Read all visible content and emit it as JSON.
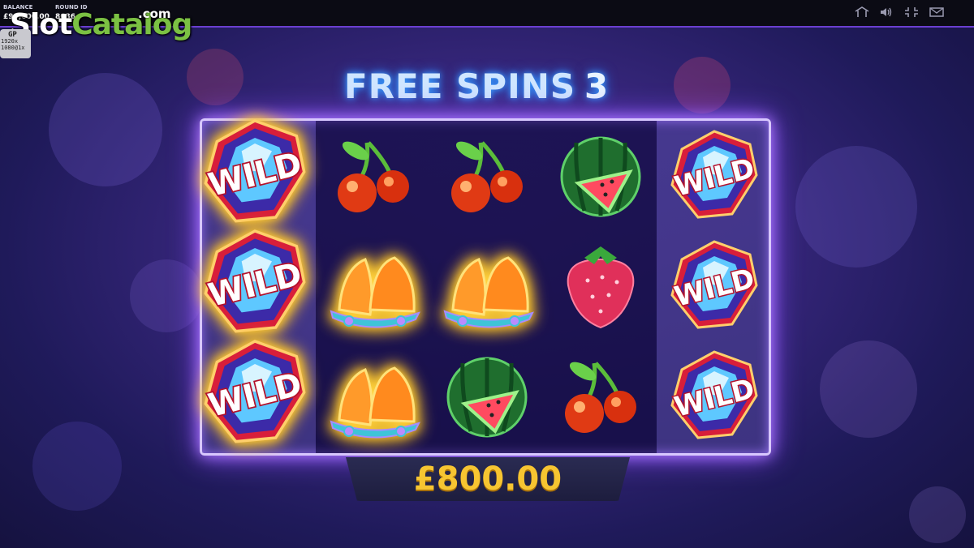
{
  "top_bar": {
    "balance_label": "BALANCE",
    "balance_value": "£99,600.00",
    "round_label": "ROUND ID",
    "round_value": "8636",
    "icons": [
      "home-icon",
      "sound-icon",
      "fullscreen-icon",
      "mail-icon"
    ]
  },
  "watermark": {
    "part1": "Slot",
    "part2": "Catalog",
    "domain": ".com"
  },
  "resolution_badge": {
    "top": "GP",
    "line1": "1920x",
    "line2": "1080@1x"
  },
  "free_spins": {
    "label": "FREE SPINS",
    "count": "3"
  },
  "reels": [
    [
      "wild",
      "wild",
      "wild"
    ],
    [
      "cherry",
      "bell",
      "bell"
    ],
    [
      "cherry",
      "bell",
      "watermelon"
    ],
    [
      "watermelon",
      "strawberry",
      "cherry"
    ],
    [
      "wild",
      "wild",
      "wild"
    ]
  ],
  "wild_text": "WILD",
  "win": {
    "amount": "£800.00"
  },
  "colors": {
    "accent": "#8a4dff",
    "win_gold": "#f7c531",
    "title_blue": "#cfe6ff"
  }
}
